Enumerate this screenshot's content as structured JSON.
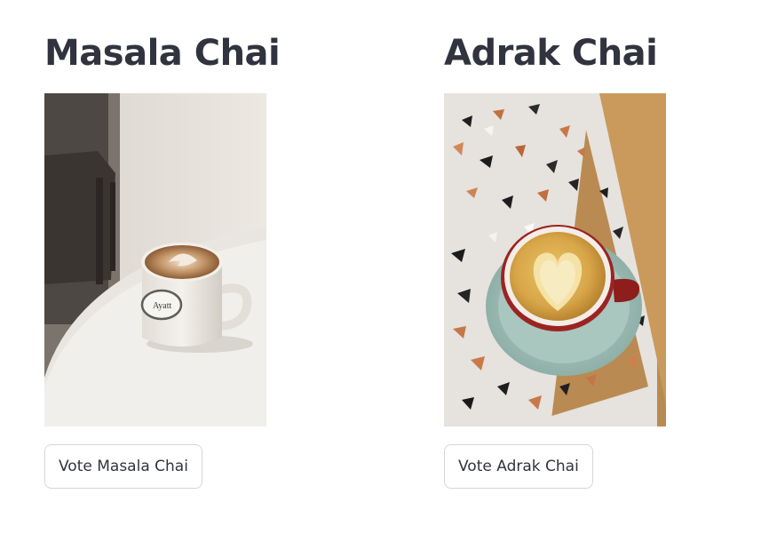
{
  "options": [
    {
      "title": "Masala Chai",
      "vote_label": "Vote Masala Chai",
      "image_alt": "cup of masala chai with latte art on white table"
    },
    {
      "title": "Adrak Chai",
      "vote_label": "Vote Adrak Chai",
      "image_alt": "cup of adrak chai with heart latte art on terrazzo table"
    }
  ],
  "colors": {
    "text": "#31333f",
    "button_border": "#d6d6d9",
    "background": "#ffffff"
  }
}
